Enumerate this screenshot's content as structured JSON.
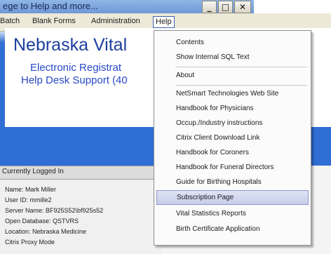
{
  "titlebar": {
    "title": "ege to Help and more...",
    "minimize": "_",
    "maximize": "□",
    "close": "✕"
  },
  "menubar": {
    "items": [
      "Batch",
      "Blank Forms",
      "Administration",
      "Help"
    ]
  },
  "main": {
    "title": "Nebraska Vital",
    "subtitle1": "Electronic Registrat",
    "subtitle2": "Help Desk Support (40"
  },
  "logged_in": {
    "header": "Currently Logged In",
    "lines": [
      "Name: Mark Miller",
      "User ID: mmille2",
      "Server Name: BF925S52\\bf925s52",
      "Open Database: QSTVRS",
      "Location: Nebraska Medicine",
      "Citrix Proxy Mode"
    ]
  },
  "help_menu": {
    "items": [
      "Contents",
      "Show Internal SQL Text",
      "About",
      "NetSmart Technologies Web Site",
      "Handbook for Physicians",
      "Occup./Industry instructions",
      "Citrix Client Download Link",
      "Handbook for Coroners",
      "Handbook for Funeral Directors",
      "Guide for Birthing Hospitals",
      "Subscription Page",
      "Vital Statistics Reports",
      "Birth Certificate Application"
    ],
    "highlighted": "Subscription Page"
  },
  "colors": {
    "app_blue": "#2f6ed4",
    "title_blue": "#1c3f9c",
    "highlight": "#c7cdea"
  }
}
